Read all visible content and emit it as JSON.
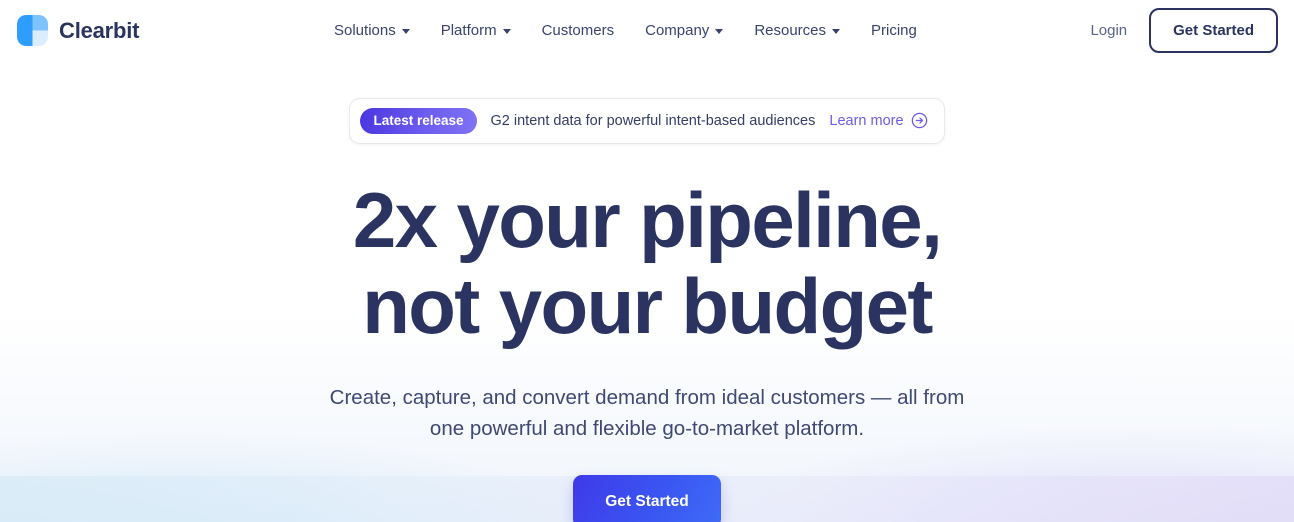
{
  "brand": {
    "name": "Clearbit",
    "logo_icon": "clearbit-logo-mark",
    "logo_colors": {
      "left": "#2f9cff",
      "top_right": "#7cc3ff",
      "bottom_right": "#dbeeff"
    }
  },
  "nav": {
    "items": [
      {
        "label": "Solutions",
        "has_dropdown": true
      },
      {
        "label": "Platform",
        "has_dropdown": true
      },
      {
        "label": "Customers",
        "has_dropdown": false
      },
      {
        "label": "Company",
        "has_dropdown": true
      },
      {
        "label": "Resources",
        "has_dropdown": true
      },
      {
        "label": "Pricing",
        "has_dropdown": false
      }
    ],
    "login_label": "Login",
    "get_started_label": "Get Started"
  },
  "announcement": {
    "badge_label": "Latest release",
    "text": "G2 intent data for powerful intent-based audiences",
    "link_label": "Learn more",
    "link_icon": "arrow-right-circle-icon",
    "badge_gradient_from": "#4a36e0",
    "badge_gradient_to": "#8073f3",
    "link_color": "#6c5ce7"
  },
  "hero": {
    "title_line1": "2x your pipeline,",
    "title_line2": "not your budget",
    "subtitle_line1": "Create, capture, and convert demand from ideal customers — all from",
    "subtitle_line2": "one powerful and flexible go-to-market platform.",
    "cta_label": "Get Started",
    "title_color": "#2b3461",
    "cta_gradient_from": "#3f3ae8",
    "cta_gradient_to": "#3f6bf6"
  }
}
